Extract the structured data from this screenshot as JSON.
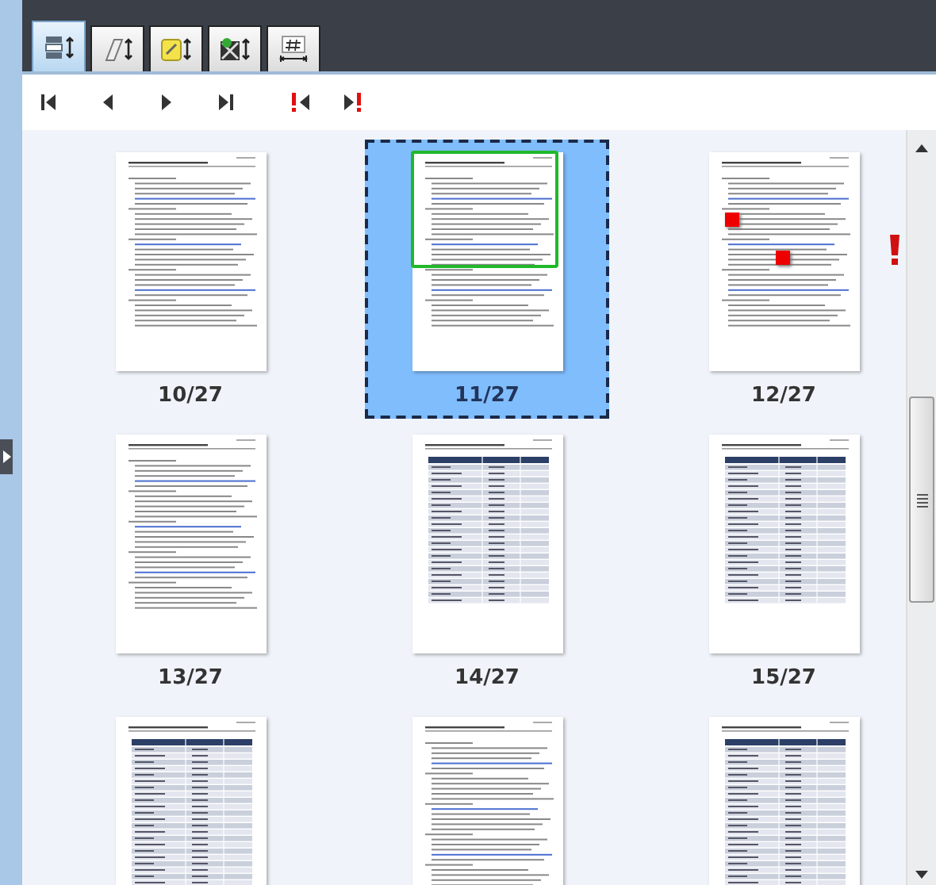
{
  "tabs": [
    {
      "kind": "pages",
      "selected": true
    },
    {
      "kind": "annotations",
      "selected": false
    },
    {
      "kind": "notes",
      "selected": false
    },
    {
      "kind": "images",
      "selected": false
    },
    {
      "kind": "numbering",
      "selected": false
    }
  ],
  "navigation": [
    {
      "kind": "first"
    },
    {
      "kind": "previous"
    },
    {
      "kind": "next"
    },
    {
      "kind": "last"
    },
    {
      "kind": "previous-flag"
    },
    {
      "kind": "next-flag"
    }
  ],
  "pages": [
    {
      "label": "10/27",
      "kind": "text",
      "selected": false,
      "in_view": false,
      "flagged": false
    },
    {
      "label": "11/27",
      "kind": "text",
      "selected": true,
      "in_view": true,
      "flagged": false
    },
    {
      "label": "12/27",
      "kind": "text",
      "selected": false,
      "in_view": false,
      "flagged": true
    },
    {
      "label": "13/27",
      "kind": "text",
      "selected": false,
      "in_view": false,
      "flagged": false
    },
    {
      "label": "14/27",
      "kind": "table",
      "selected": false,
      "in_view": false,
      "flagged": false
    },
    {
      "label": "15/27",
      "kind": "table",
      "selected": false,
      "in_view": false,
      "flagged": false
    },
    {
      "kind": "table",
      "selected": false,
      "in_view": false,
      "flagged": false
    },
    {
      "kind": "text",
      "selected": false,
      "in_view": false,
      "flagged": false
    },
    {
      "kind": "table",
      "selected": false,
      "in_view": false,
      "flagged": false
    }
  ]
}
